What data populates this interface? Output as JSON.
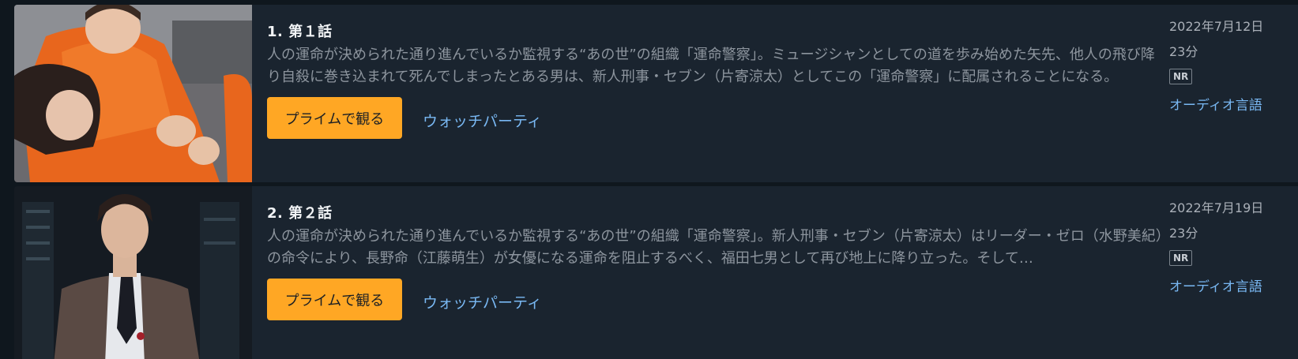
{
  "episodes": [
    {
      "title": "1. 第１話",
      "synopsis": "人の運命が決められた通り進んでいるか監視する“あの世”の組織「運命警察」。ミュージシャンとしての道を歩み始めた矢先、他人の飛び降り自殺に巻き込まれて死んでしまったとある男は、新人刑事・セブン（片寄涼太）としてこの「運命警察」に配属されることになる。",
      "play_label": "プライムで観る",
      "watch_party_label": "ウォッチパーティ",
      "date": "2022年7月12日",
      "duration": "23分",
      "rating": "NR",
      "audio_label": "オーディオ言語"
    },
    {
      "title": "2. 第２話",
      "synopsis": "人の運命が決められた通り進んでいるか監視する“あの世”の組織「運命警察」。新人刑事・セブン（片寄涼太）はリーダー・ゼロ（水野美紀）の命令により、長野命（江藤萌生）が女優になる運命を阻止するべく、福田七男として再び地上に降り立った。そして…",
      "play_label": "プライムで観る",
      "watch_party_label": "ウォッチパーティ",
      "date": "2022年7月19日",
      "duration": "23分",
      "rating": "NR",
      "audio_label": "オーディオ言語"
    }
  ]
}
